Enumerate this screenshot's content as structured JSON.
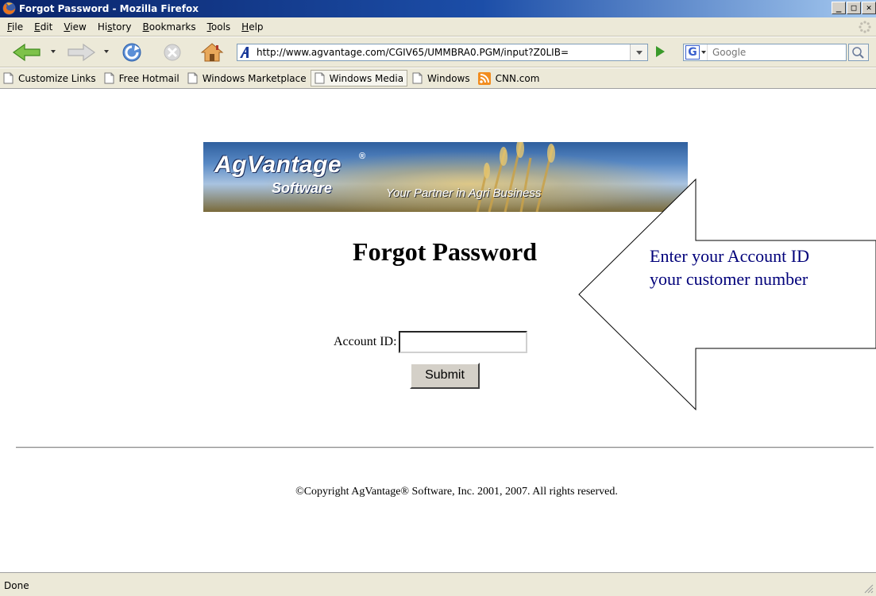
{
  "window": {
    "title": "Forgot Password - Mozilla Firefox",
    "buttons": [
      "minimize",
      "maximize",
      "close"
    ]
  },
  "menubar": {
    "items": [
      {
        "label": "File"
      },
      {
        "label": "Edit"
      },
      {
        "label": "View"
      },
      {
        "label": "History"
      },
      {
        "label": "Bookmarks"
      },
      {
        "label": "Tools"
      },
      {
        "label": "Help"
      }
    ]
  },
  "navbar": {
    "url": "http://www.agvantage.com/CGIV65/UMMBRA0.PGM/input?Z0LIB=",
    "search_placeholder": "Google"
  },
  "bookmarks": {
    "items": [
      {
        "label": "Customize Links",
        "icon": "page-icon"
      },
      {
        "label": "Free Hotmail",
        "icon": "page-icon"
      },
      {
        "label": "Windows Marketplace",
        "icon": "page-icon"
      },
      {
        "label": "Windows Media",
        "icon": "page-icon"
      },
      {
        "label": "Windows",
        "icon": "page-icon"
      },
      {
        "label": "CNN.com",
        "icon": "rss-feed-icon"
      }
    ]
  },
  "page": {
    "banner": {
      "brand_top": "AgVantage",
      "registered_mark": "®",
      "brand_bottom": "Software",
      "tagline": "Your Partner in Agri Business"
    },
    "heading": "Forgot Password",
    "account_label": "Account ID:",
    "account_value": "",
    "submit_label": "Submit",
    "copyright": "©Copyright AgVantage® Software, Inc. 2001, 2007. All rights reserved."
  },
  "callout": {
    "line1": "Enter your Account ID",
    "line2": "your customer number"
  },
  "statusbar": {
    "text": "Done"
  }
}
